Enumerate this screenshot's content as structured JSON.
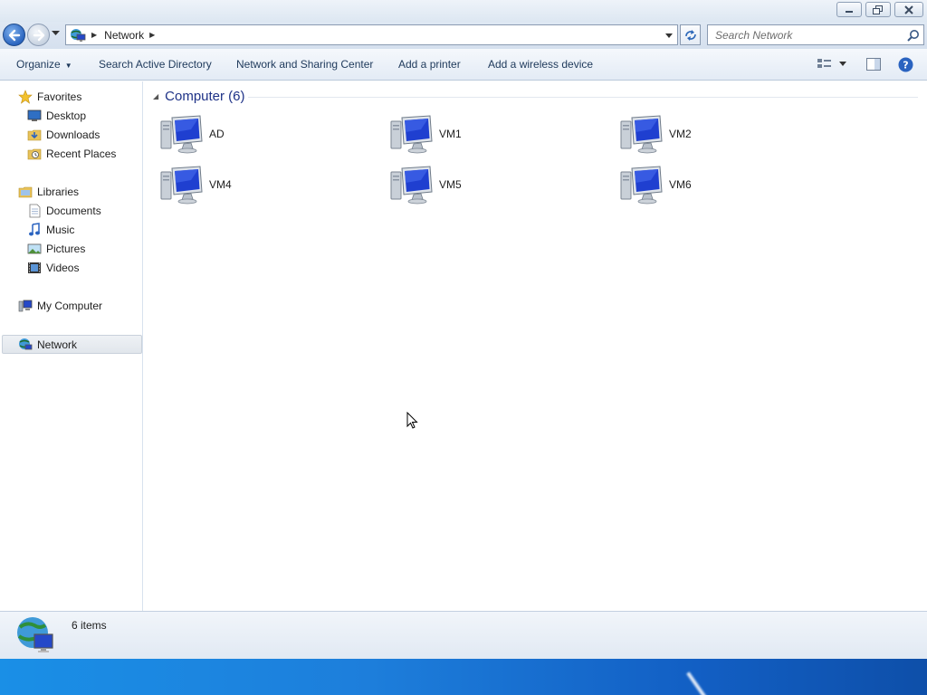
{
  "titlebar": {
    "minimize": "minimize",
    "restore": "restore",
    "close": "close"
  },
  "address": {
    "location": "Network"
  },
  "search": {
    "placeholder": "Search Network"
  },
  "commands": {
    "organize": "Organize",
    "search_ad": "Search Active Directory",
    "network_sharing": "Network and Sharing Center",
    "add_printer": "Add a printer",
    "add_wireless": "Add a wireless device"
  },
  "navpane": {
    "favorites": "Favorites",
    "desktop": "Desktop",
    "downloads": "Downloads",
    "recent_places": "Recent Places",
    "libraries": "Libraries",
    "documents": "Documents",
    "music": "Music",
    "pictures": "Pictures",
    "videos": "Videos",
    "my_computer": "My Computer",
    "network": "Network"
  },
  "content": {
    "group_title": "Computer (6)",
    "computers": [
      "AD",
      "VM1",
      "VM2",
      "VM4",
      "VM5",
      "VM6"
    ]
  },
  "status": {
    "item_count": "6 items"
  },
  "colors": {
    "accent": "#1e3287",
    "selection": "#e1e6ec",
    "taskbar": "#1d7edb"
  },
  "icons": [
    "back-icon",
    "forward-icon",
    "network-icon",
    "refresh-icon",
    "search-icon",
    "views-icon",
    "preview-pane-icon",
    "help-icon",
    "star-icon",
    "folder-icon",
    "computer-icon",
    "globe-icon"
  ]
}
